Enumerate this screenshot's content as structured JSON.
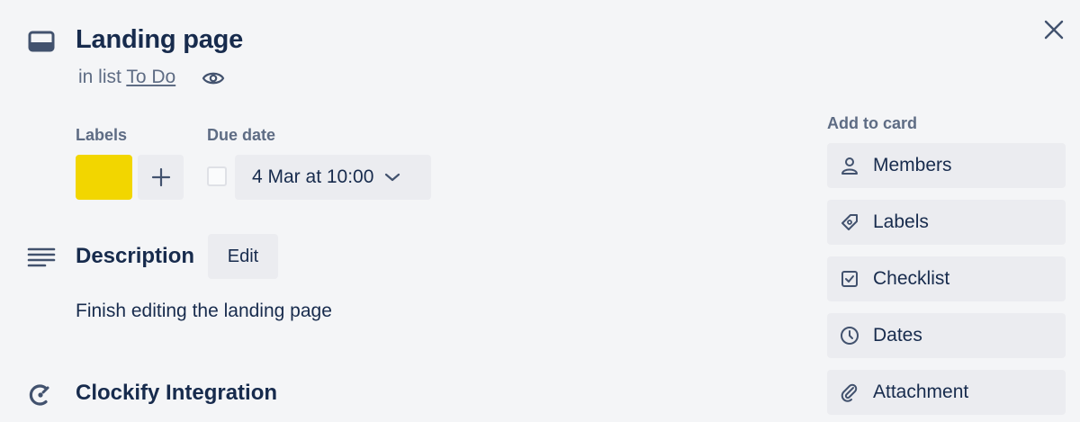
{
  "card": {
    "title": "Landing page",
    "in_list_prefix": "in list",
    "list_name": "To Do"
  },
  "labels": {
    "heading": "Labels",
    "items": [
      {
        "color": "#f2d600"
      }
    ]
  },
  "due": {
    "heading": "Due date",
    "value": "4 Mar at 10:00",
    "completed": false
  },
  "description": {
    "heading": "Description",
    "edit_label": "Edit",
    "text": "Finish editing the landing page"
  },
  "clockify": {
    "heading": "Clockify Integration"
  },
  "sidebar": {
    "heading": "Add to card",
    "items": [
      {
        "label": "Members",
        "icon": "person-icon"
      },
      {
        "label": "Labels",
        "icon": "tag-icon"
      },
      {
        "label": "Checklist",
        "icon": "checklist-icon"
      },
      {
        "label": "Dates",
        "icon": "clock-icon"
      },
      {
        "label": "Attachment",
        "icon": "paperclip-icon"
      }
    ]
  }
}
